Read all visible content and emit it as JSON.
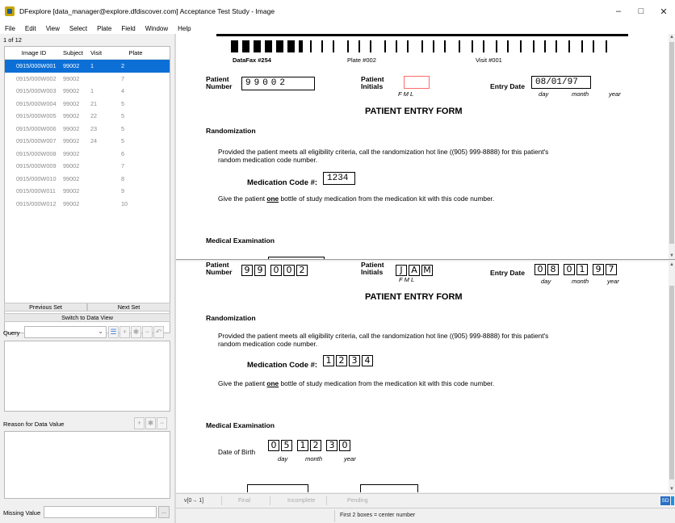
{
  "window": {
    "title": "DFexplore [data_manager@explore.dfdiscover.com] Acceptance Test Study - Image",
    "minimize": "–",
    "maximize": "□",
    "close": "✕"
  },
  "menu": [
    "File",
    "Edit",
    "View",
    "Select",
    "Plate",
    "Field",
    "Window",
    "Help"
  ],
  "left": {
    "count": "1 of 12",
    "columns": [
      "Image ID",
      "Subject",
      "Visit",
      "Plate"
    ],
    "rows": [
      {
        "id": "0915/000W001",
        "subject": "99002",
        "visit": "1",
        "plate": "2"
      },
      {
        "id": "0915/000W002",
        "subject": "99002",
        "visit": "",
        "plate": "7"
      },
      {
        "id": "0915/000W003",
        "subject": "99002",
        "visit": "1",
        "plate": "4"
      },
      {
        "id": "0915/000W004",
        "subject": "99002",
        "visit": "21",
        "plate": "5"
      },
      {
        "id": "0915/000W005",
        "subject": "99002",
        "visit": "22",
        "plate": "5"
      },
      {
        "id": "0915/000W006",
        "subject": "99002",
        "visit": "23",
        "plate": "5"
      },
      {
        "id": "0915/000W007",
        "subject": "99002",
        "visit": "24",
        "plate": "5"
      },
      {
        "id": "0915/000W008",
        "subject": "99002",
        "visit": "",
        "plate": "6"
      },
      {
        "id": "0915/000W009",
        "subject": "99002",
        "visit": "",
        "plate": "7"
      },
      {
        "id": "0915/000W010",
        "subject": "99002",
        "visit": "",
        "plate": "8"
      },
      {
        "id": "0915/000W011",
        "subject": "99002",
        "visit": "",
        "plate": "9"
      },
      {
        "id": "0915/000W012",
        "subject": "99002",
        "visit": "",
        "plate": "10"
      }
    ],
    "prev_set": "Previous Set",
    "next_set": "Next Set",
    "switch": "Switch to Data View",
    "query_label": "Query",
    "reason_label": "Reason for Data Value",
    "missing_label": "Missing Value",
    "missing_btn": "..."
  },
  "form_top": {
    "fax": "DataFax #254",
    "plate": "Plate #002",
    "visit": "Visit #001",
    "patient_number_label_1": "Patient",
    "patient_number_label_2": "Number",
    "patient_number_value": "99002",
    "patient_initials_label_1": "Patient",
    "patient_initials_label_2": "Initials",
    "initials_hint": "F   M   L",
    "entry_date_label": "Entry Date",
    "entry_date_value": "08/01/97",
    "date_day": "day",
    "date_month": "month",
    "date_year": "year",
    "title": "PATIENT ENTRY FORM",
    "randomization": "Randomization",
    "rand_text_1": "Provided the patient meets all eligibility criteria, call the randomization hot line ((905) 999-8888) for this patient's",
    "rand_text_2": "random medication code number.",
    "med_code_label": "Medication Code #:",
    "med_code_value": "1234",
    "give_text_pre": "Give the patient ",
    "give_text_one": "one",
    "give_text_post": " bottle of study medication from the medication kit with this code number.",
    "medical_exam": "Medical Examination"
  },
  "form_bottom": {
    "patient_number_label_1": "Patient",
    "patient_number_label_2": "Number",
    "patient_number_digits": [
      "9",
      "9",
      "0",
      "0",
      "2"
    ],
    "patient_initials_label_1": "Patient",
    "patient_initials_label_2": "Initials",
    "initials": [
      "J",
      "A",
      "M"
    ],
    "initials_hint": "F  M  L",
    "entry_date_label": "Entry Date",
    "entry_digits": [
      "0",
      "8",
      "0",
      "1",
      "9",
      "7"
    ],
    "date_day": "day",
    "date_month": "month",
    "date_year": "year",
    "title": "PATIENT ENTRY FORM",
    "randomization": "Randomization",
    "rand_text_1": "Provided the patient meets all eligibility criteria, call the randomization hot line ((905) 999-8888) for this patient's",
    "rand_text_2": "random medication code number.",
    "med_code_label": "Medication Code #:",
    "med_code_digits": [
      "1",
      "2",
      "3",
      "4"
    ],
    "give_text_pre": "Give the patient ",
    "give_text_one": "one",
    "give_text_post": " bottle of study medication from the medication kit with this code number.",
    "medical_exam": "Medical Examination",
    "dob_label": "Date of Birth",
    "dob_digits": [
      "0",
      "5",
      "1",
      "2",
      "3",
      "0"
    ],
    "dob_day": "day",
    "dob_month": "month",
    "dob_year": "year"
  },
  "status": {
    "field_range": "v[0→ 1]",
    "final": "Final",
    "incomplete": "Incomplete",
    "pending": "Pending",
    "chip_sd": "SD",
    "message": "First 2 boxes = center number"
  }
}
